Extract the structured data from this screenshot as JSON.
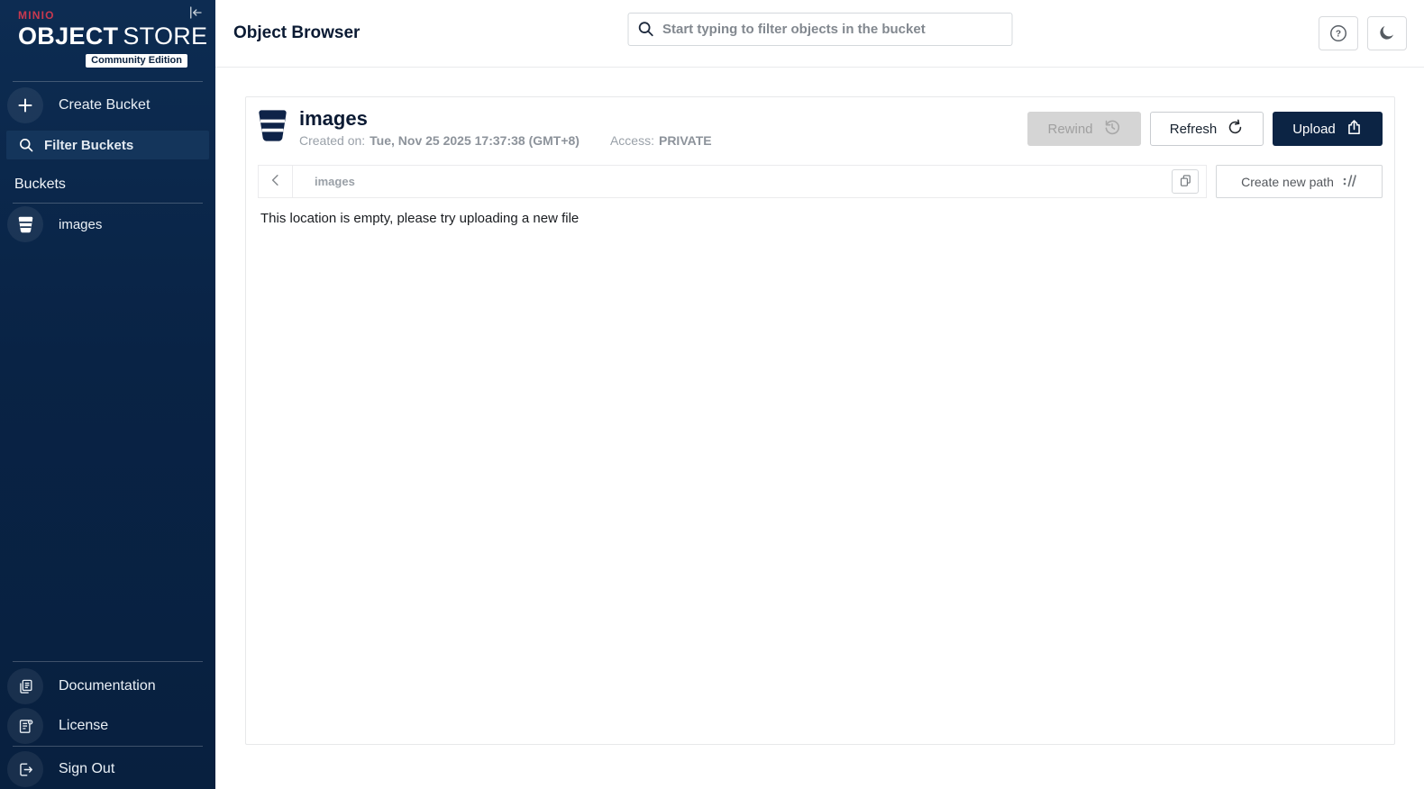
{
  "sidebar": {
    "logo": {
      "brand": "MINIO",
      "title_bold": "OBJECT",
      "title_light": "STORE",
      "badge": "Community Edition"
    },
    "items": {
      "create_bucket": "Create Bucket"
    },
    "filter": {
      "placeholder": "Filter Buckets"
    },
    "section_label": "Buckets",
    "buckets": [
      {
        "name": "images"
      }
    ],
    "footer": [
      {
        "label": "Documentation"
      },
      {
        "label": "License"
      },
      {
        "label": "Sign Out"
      }
    ]
  },
  "topbar": {
    "title": "Object Browser",
    "search": {
      "placeholder": "Start typing to filter objects in the bucket"
    },
    "help_glyph": "?"
  },
  "panel": {
    "bucket_name": "images",
    "created_label": "Created on:",
    "created_value": "Tue, Nov 25 2025 17:37:38 (GMT+8)",
    "access_label": "Access:",
    "access_value": "PRIVATE",
    "buttons": {
      "rewind": "Rewind",
      "refresh": "Refresh",
      "upload": "Upload",
      "create_path": "Create new path"
    },
    "breadcrumb": {
      "path": "images"
    },
    "empty_message": "This location is empty, please try uploading a new file"
  },
  "colors": {
    "sidebar_navy": "#092345",
    "brand_red": "#C9394F",
    "primary_navy": "#0C2444",
    "disabled_gray": "#D5D5D5",
    "border_gray": "#D4D7DA"
  }
}
